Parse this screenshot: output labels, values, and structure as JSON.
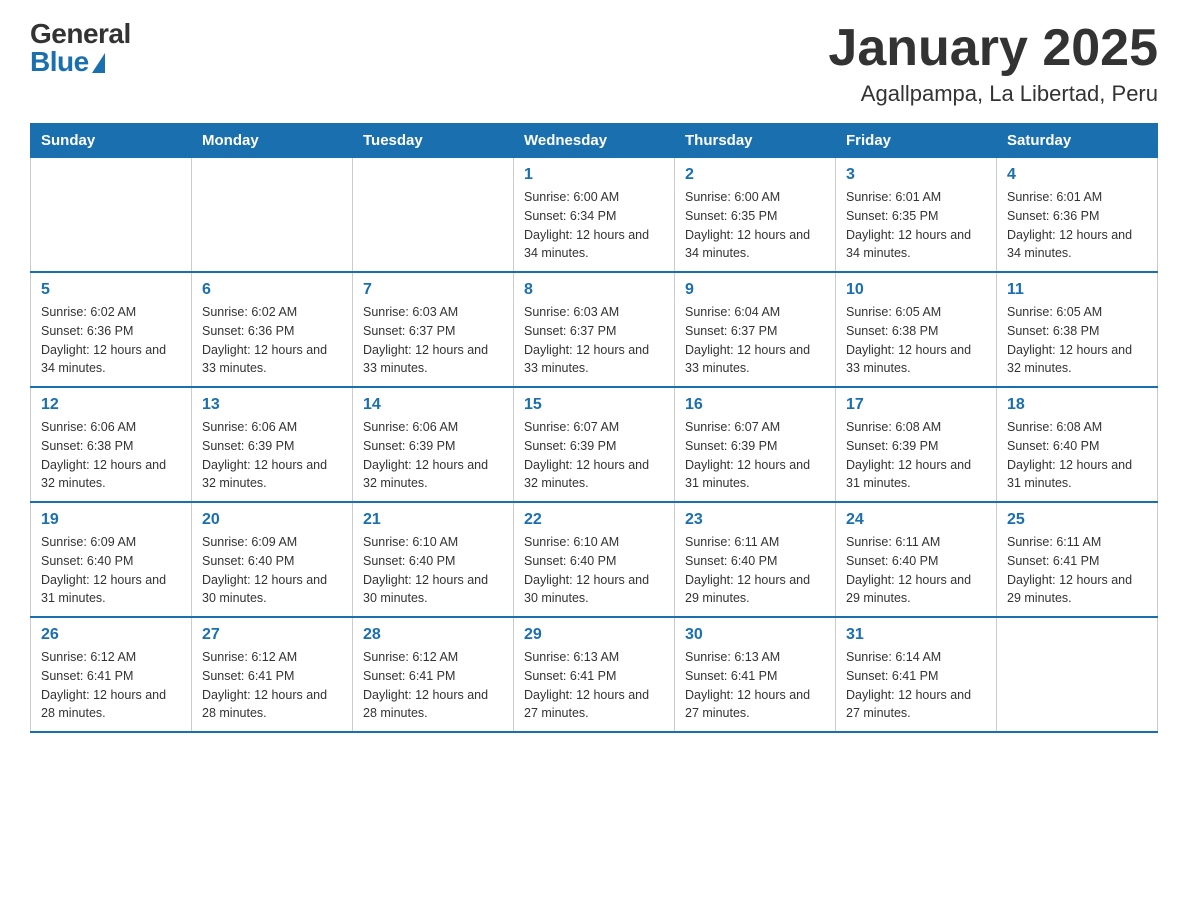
{
  "header": {
    "title": "January 2025",
    "subtitle": "Agallpampa, La Libertad, Peru",
    "logo_general": "General",
    "logo_blue": "Blue"
  },
  "days_of_week": [
    "Sunday",
    "Monday",
    "Tuesday",
    "Wednesday",
    "Thursday",
    "Friday",
    "Saturday"
  ],
  "weeks": [
    {
      "days": [
        {
          "number": "",
          "info": ""
        },
        {
          "number": "",
          "info": ""
        },
        {
          "number": "",
          "info": ""
        },
        {
          "number": "1",
          "info": "Sunrise: 6:00 AM\nSunset: 6:34 PM\nDaylight: 12 hours and 34 minutes."
        },
        {
          "number": "2",
          "info": "Sunrise: 6:00 AM\nSunset: 6:35 PM\nDaylight: 12 hours and 34 minutes."
        },
        {
          "number": "3",
          "info": "Sunrise: 6:01 AM\nSunset: 6:35 PM\nDaylight: 12 hours and 34 minutes."
        },
        {
          "number": "4",
          "info": "Sunrise: 6:01 AM\nSunset: 6:36 PM\nDaylight: 12 hours and 34 minutes."
        }
      ]
    },
    {
      "days": [
        {
          "number": "5",
          "info": "Sunrise: 6:02 AM\nSunset: 6:36 PM\nDaylight: 12 hours and 34 minutes."
        },
        {
          "number": "6",
          "info": "Sunrise: 6:02 AM\nSunset: 6:36 PM\nDaylight: 12 hours and 33 minutes."
        },
        {
          "number": "7",
          "info": "Sunrise: 6:03 AM\nSunset: 6:37 PM\nDaylight: 12 hours and 33 minutes."
        },
        {
          "number": "8",
          "info": "Sunrise: 6:03 AM\nSunset: 6:37 PM\nDaylight: 12 hours and 33 minutes."
        },
        {
          "number": "9",
          "info": "Sunrise: 6:04 AM\nSunset: 6:37 PM\nDaylight: 12 hours and 33 minutes."
        },
        {
          "number": "10",
          "info": "Sunrise: 6:05 AM\nSunset: 6:38 PM\nDaylight: 12 hours and 33 minutes."
        },
        {
          "number": "11",
          "info": "Sunrise: 6:05 AM\nSunset: 6:38 PM\nDaylight: 12 hours and 32 minutes."
        }
      ]
    },
    {
      "days": [
        {
          "number": "12",
          "info": "Sunrise: 6:06 AM\nSunset: 6:38 PM\nDaylight: 12 hours and 32 minutes."
        },
        {
          "number": "13",
          "info": "Sunrise: 6:06 AM\nSunset: 6:39 PM\nDaylight: 12 hours and 32 minutes."
        },
        {
          "number": "14",
          "info": "Sunrise: 6:06 AM\nSunset: 6:39 PM\nDaylight: 12 hours and 32 minutes."
        },
        {
          "number": "15",
          "info": "Sunrise: 6:07 AM\nSunset: 6:39 PM\nDaylight: 12 hours and 32 minutes."
        },
        {
          "number": "16",
          "info": "Sunrise: 6:07 AM\nSunset: 6:39 PM\nDaylight: 12 hours and 31 minutes."
        },
        {
          "number": "17",
          "info": "Sunrise: 6:08 AM\nSunset: 6:39 PM\nDaylight: 12 hours and 31 minutes."
        },
        {
          "number": "18",
          "info": "Sunrise: 6:08 AM\nSunset: 6:40 PM\nDaylight: 12 hours and 31 minutes."
        }
      ]
    },
    {
      "days": [
        {
          "number": "19",
          "info": "Sunrise: 6:09 AM\nSunset: 6:40 PM\nDaylight: 12 hours and 31 minutes."
        },
        {
          "number": "20",
          "info": "Sunrise: 6:09 AM\nSunset: 6:40 PM\nDaylight: 12 hours and 30 minutes."
        },
        {
          "number": "21",
          "info": "Sunrise: 6:10 AM\nSunset: 6:40 PM\nDaylight: 12 hours and 30 minutes."
        },
        {
          "number": "22",
          "info": "Sunrise: 6:10 AM\nSunset: 6:40 PM\nDaylight: 12 hours and 30 minutes."
        },
        {
          "number": "23",
          "info": "Sunrise: 6:11 AM\nSunset: 6:40 PM\nDaylight: 12 hours and 29 minutes."
        },
        {
          "number": "24",
          "info": "Sunrise: 6:11 AM\nSunset: 6:40 PM\nDaylight: 12 hours and 29 minutes."
        },
        {
          "number": "25",
          "info": "Sunrise: 6:11 AM\nSunset: 6:41 PM\nDaylight: 12 hours and 29 minutes."
        }
      ]
    },
    {
      "days": [
        {
          "number": "26",
          "info": "Sunrise: 6:12 AM\nSunset: 6:41 PM\nDaylight: 12 hours and 28 minutes."
        },
        {
          "number": "27",
          "info": "Sunrise: 6:12 AM\nSunset: 6:41 PM\nDaylight: 12 hours and 28 minutes."
        },
        {
          "number": "28",
          "info": "Sunrise: 6:12 AM\nSunset: 6:41 PM\nDaylight: 12 hours and 28 minutes."
        },
        {
          "number": "29",
          "info": "Sunrise: 6:13 AM\nSunset: 6:41 PM\nDaylight: 12 hours and 27 minutes."
        },
        {
          "number": "30",
          "info": "Sunrise: 6:13 AM\nSunset: 6:41 PM\nDaylight: 12 hours and 27 minutes."
        },
        {
          "number": "31",
          "info": "Sunrise: 6:14 AM\nSunset: 6:41 PM\nDaylight: 12 hours and 27 minutes."
        },
        {
          "number": "",
          "info": ""
        }
      ]
    }
  ]
}
